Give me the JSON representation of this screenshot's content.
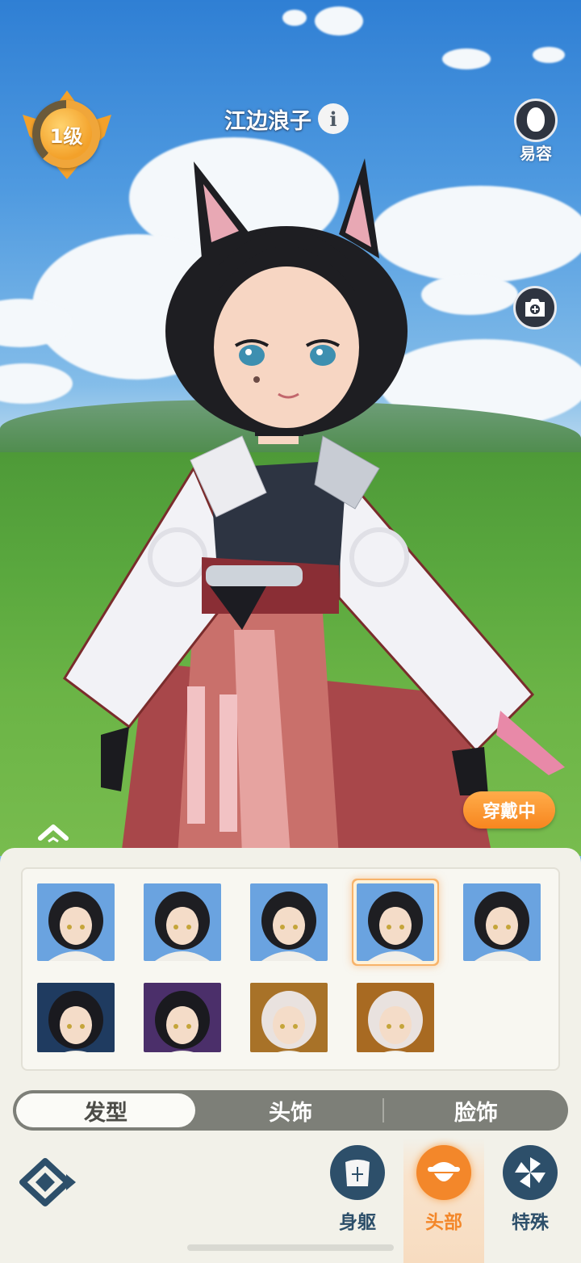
{
  "hud": {
    "level_label": "1级",
    "character_name": "江边浪子",
    "info_icon": "info-icon",
    "appearance_label": "易容",
    "appearance_icon": "face-mask-icon",
    "camera_icon": "camera-plus-icon",
    "wearing_label": "穿戴中",
    "expand_icon": "chevron-up-icon"
  },
  "hairstyles": {
    "items": [
      {
        "name": "hairstyle-1",
        "selected": false,
        "bg": "#6aa3e0"
      },
      {
        "name": "hairstyle-2",
        "selected": false,
        "bg": "#6aa3e0"
      },
      {
        "name": "hairstyle-3",
        "selected": false,
        "bg": "#6aa3e0"
      },
      {
        "name": "hairstyle-4",
        "selected": true,
        "bg": "#6aa3e0"
      },
      {
        "name": "hairstyle-5",
        "selected": false,
        "bg": "#6aa3e0"
      },
      {
        "name": "hairstyle-6",
        "selected": false,
        "bg": "#1f3b60"
      },
      {
        "name": "hairstyle-7",
        "selected": false,
        "bg": "#4b2f6a"
      },
      {
        "name": "hairstyle-8",
        "selected": false,
        "bg": "#a87228"
      },
      {
        "name": "hairstyle-9",
        "selected": false,
        "bg": "#a86a22"
      }
    ]
  },
  "tabs": [
    {
      "label": "发型",
      "active": true
    },
    {
      "label": "头饰",
      "active": false
    },
    {
      "label": "脸饰",
      "active": false
    }
  ],
  "categories": [
    {
      "label": "身躯",
      "icon": "torso-icon",
      "active": false
    },
    {
      "label": "头部",
      "icon": "head-icon",
      "active": true
    },
    {
      "label": "特殊",
      "icon": "pinwheel-icon",
      "active": false
    }
  ],
  "colors": {
    "accent": "#f3872a",
    "panel": "#f2f1e9",
    "tab_bar": "#7d7f78"
  }
}
